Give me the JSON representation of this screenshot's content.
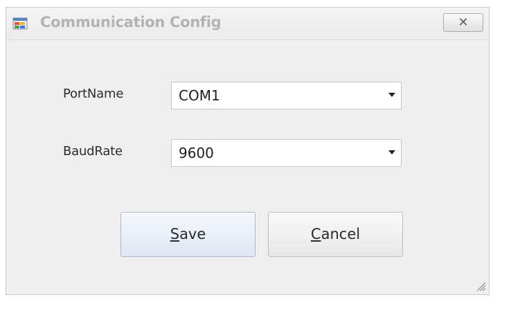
{
  "window": {
    "title": "Communication Config",
    "close_glyph": "✕"
  },
  "form": {
    "port": {
      "label": "PortName",
      "value": "COM1"
    },
    "baud": {
      "label": "BaudRate",
      "value": "9600"
    }
  },
  "buttons": {
    "save": {
      "mnemonic": "S",
      "rest": "ave"
    },
    "cancel": {
      "mnemonic": "C",
      "rest": "ancel"
    }
  },
  "colors": {
    "window_bg": "#efefef",
    "title_text": "#b3b3b3",
    "save_button_tint": "#dfe7f4"
  }
}
